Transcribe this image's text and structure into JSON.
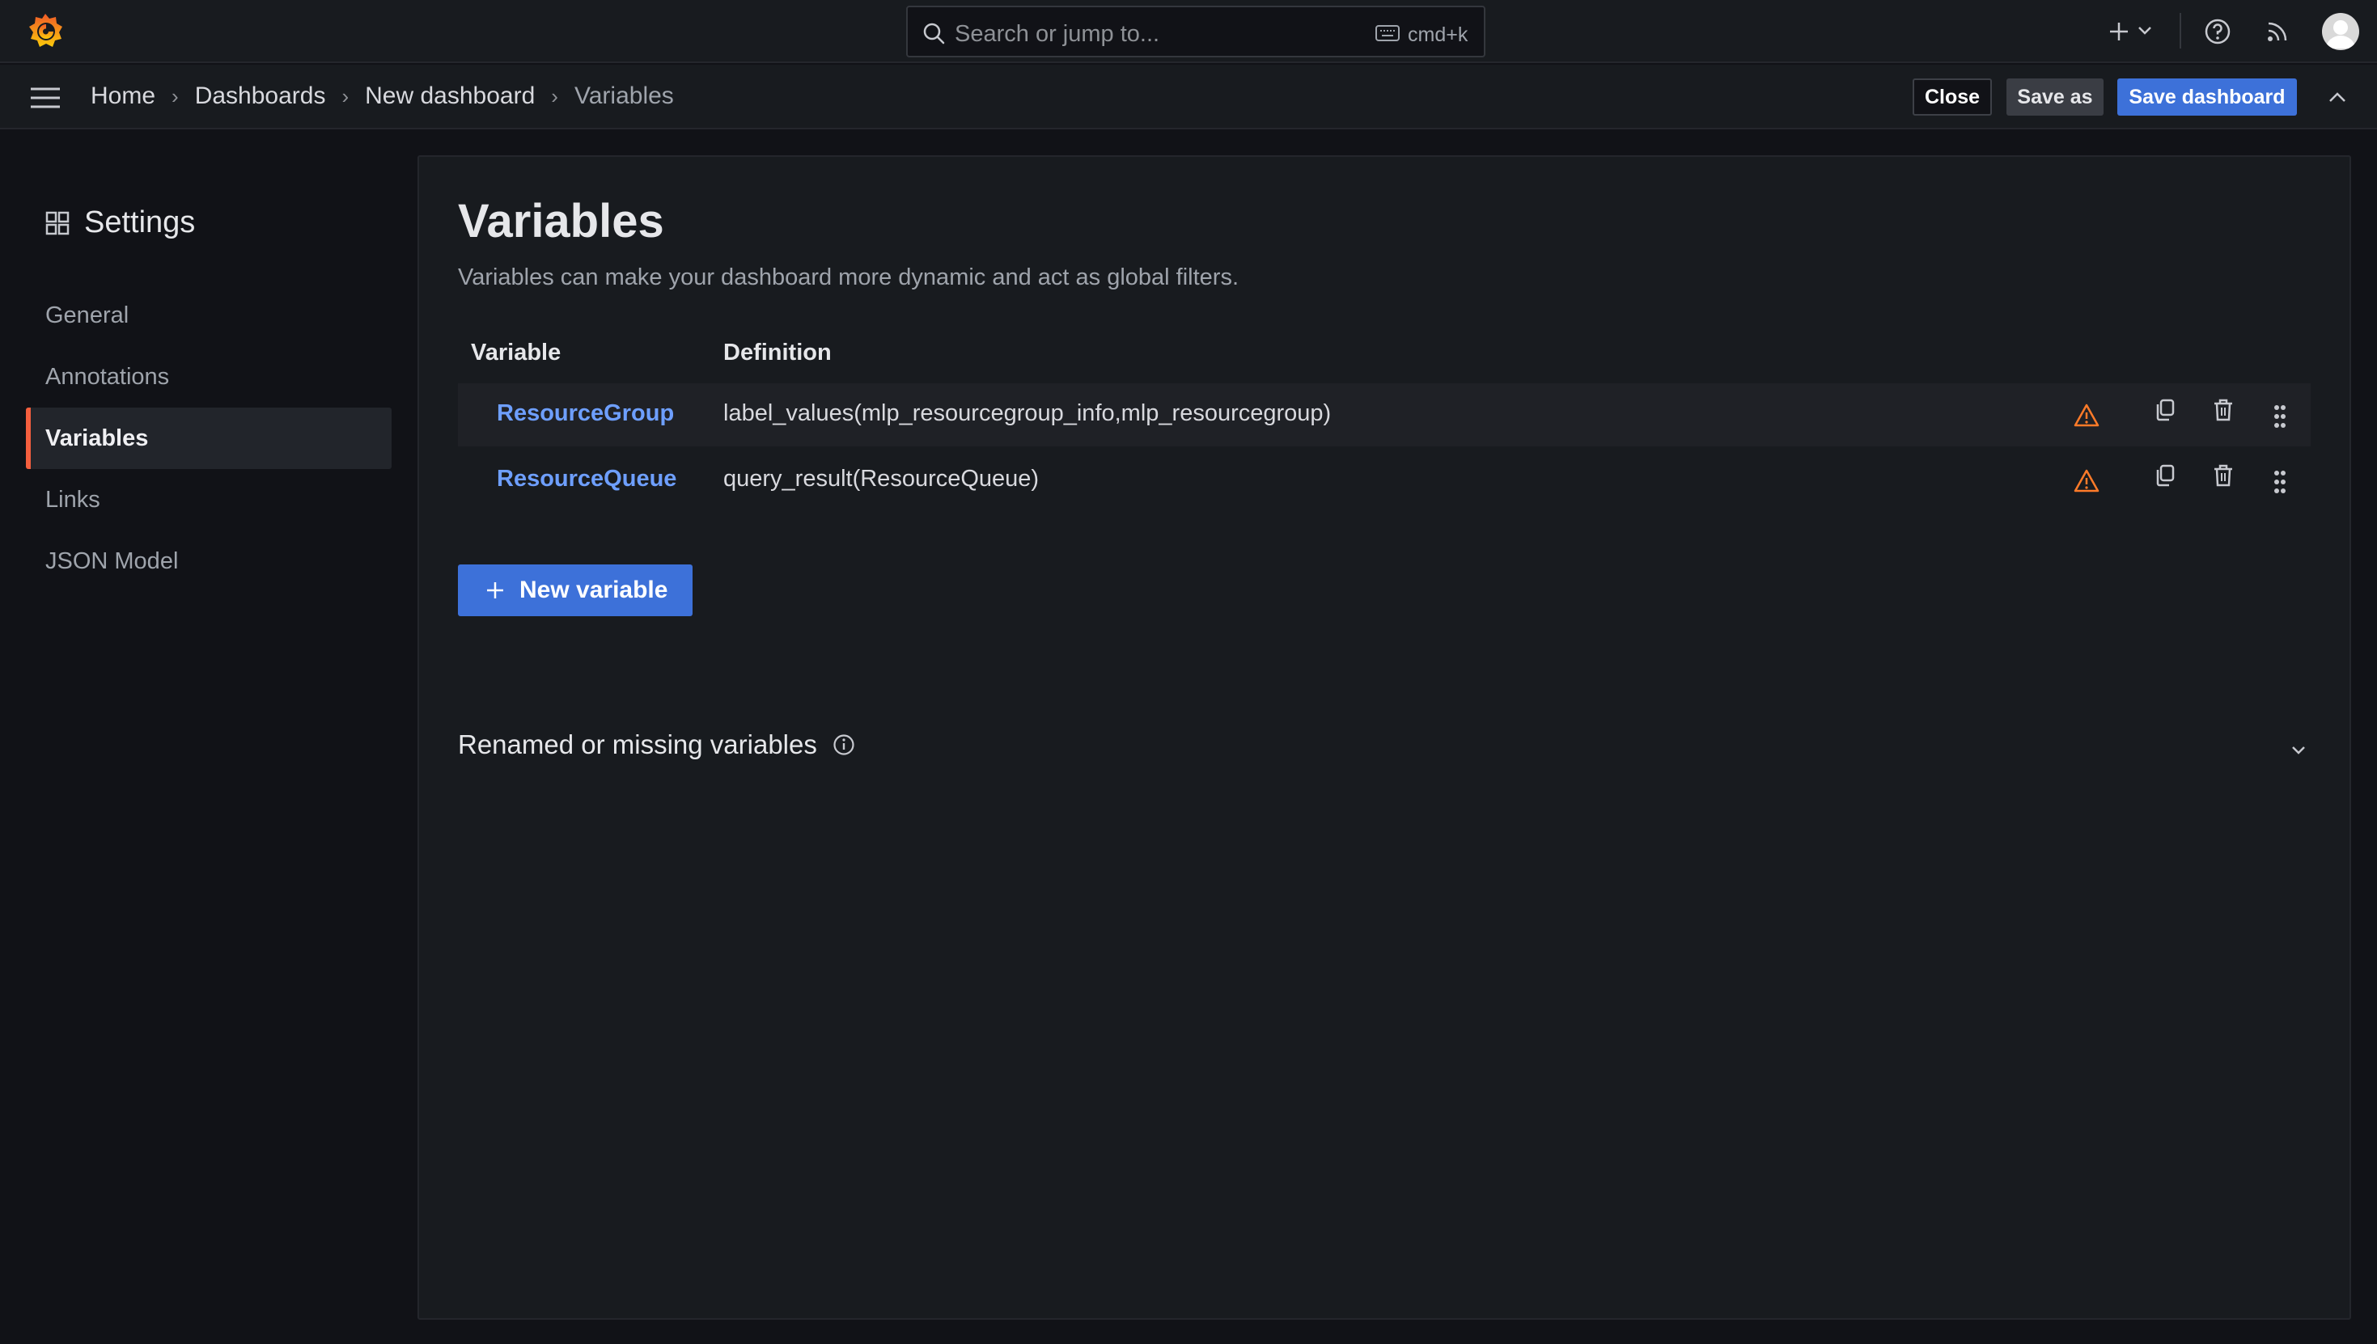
{
  "search": {
    "placeholder": "Search or jump to...",
    "shortcut": "cmd+k"
  },
  "breadcrumb": [
    {
      "label": "Home"
    },
    {
      "label": "Dashboards"
    },
    {
      "label": "New dashboard"
    },
    {
      "label": "Variables"
    }
  ],
  "toolbar": {
    "close_label": "Close",
    "save_as_label": "Save as",
    "save_label": "Save dashboard"
  },
  "sidebar": {
    "title": "Settings",
    "items": [
      {
        "label": "General"
      },
      {
        "label": "Annotations"
      },
      {
        "label": "Variables",
        "active": true
      },
      {
        "label": "Links"
      },
      {
        "label": "JSON Model"
      }
    ]
  },
  "main": {
    "title": "Variables",
    "description": "Variables can make your dashboard more dynamic and act as global filters.",
    "columns": [
      "Variable",
      "Definition"
    ],
    "rows": [
      {
        "name": "ResourceGroup",
        "definition": "label_values(mlp_resourcegroup_info,mlp_resourcegroup)"
      },
      {
        "name": "ResourceQueue",
        "definition": "query_result(ResourceQueue)"
      }
    ],
    "new_variable_label": "New variable",
    "renamed_section_label": "Renamed or missing variables"
  },
  "colors": {
    "accent": "#3d71d9",
    "link": "#6e9fff",
    "warning": "#ff7b29",
    "active_indicator": "#f55f3e"
  }
}
